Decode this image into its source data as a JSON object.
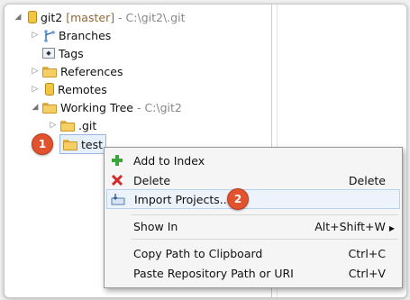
{
  "tree": {
    "repo": {
      "name": "git2",
      "branch": "[master]",
      "path": "- C:\\git2\\.git"
    },
    "items": [
      {
        "label": "Branches"
      },
      {
        "label": "Tags"
      },
      {
        "label": "References"
      },
      {
        "label": "Remotes"
      },
      {
        "label": "Working Tree",
        "path": "- C:\\git2"
      },
      {
        "label": ".git"
      },
      {
        "label": "test"
      }
    ]
  },
  "badges": {
    "step1": "1",
    "step2": "2"
  },
  "context_menu": {
    "items": [
      {
        "label": "Add to Index",
        "shortcut": "",
        "icon": "plus-icon"
      },
      {
        "label": "Delete",
        "shortcut": "Delete",
        "icon": "red-x-icon"
      },
      {
        "label": "Import Projects...",
        "shortcut": "",
        "icon": "import-icon"
      },
      {
        "label": "Show In",
        "shortcut": "Alt+Shift+W",
        "icon": ""
      },
      {
        "label": "Copy Path to Clipboard",
        "shortcut": "Ctrl+C",
        "icon": ""
      },
      {
        "label": "Paste Repository Path or URI",
        "shortcut": "Ctrl+V",
        "icon": ""
      }
    ]
  },
  "colors": {
    "badge": "#e0532e",
    "highlight": "#ecf3fc"
  }
}
